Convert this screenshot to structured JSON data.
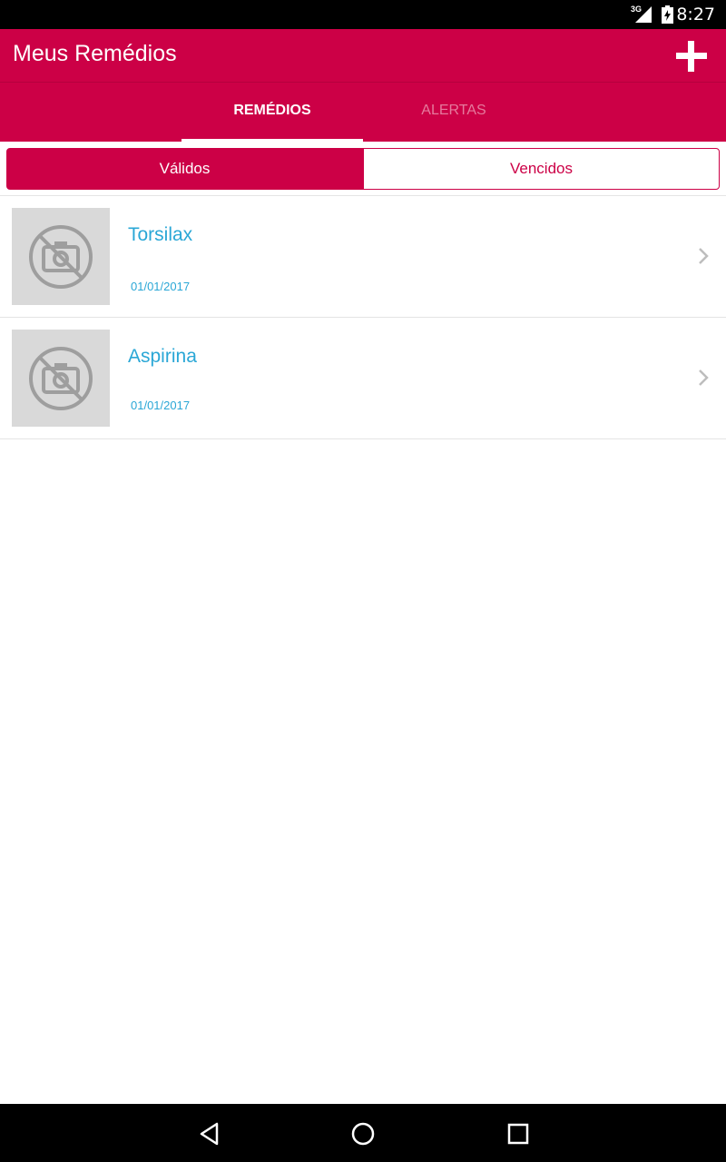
{
  "status_bar": {
    "network": "3G",
    "time": "8:27"
  },
  "app_bar": {
    "title": "Meus Remédios",
    "add_icon": "plus-icon"
  },
  "tabs": [
    {
      "label": "REMÉDIOS",
      "active": true
    },
    {
      "label": "ALERTAS",
      "active": false
    }
  ],
  "filter": {
    "valid_label": "Válidos",
    "expired_label": "Vencidos",
    "selected": "Válidos"
  },
  "medicines": [
    {
      "name": "Torsilax",
      "date": "01/01/2017",
      "thumb_icon": "no-photo-icon"
    },
    {
      "name": "Aspirina",
      "date": "01/01/2017",
      "thumb_icon": "no-photo-icon"
    }
  ],
  "colors": {
    "primary": "#cc0046",
    "accent_text": "#2aa7d6",
    "thumb_bg": "#d9d9d9"
  },
  "nav": {
    "back_icon": "back-triangle-icon",
    "home_icon": "home-circle-icon",
    "recent_icon": "recent-square-icon"
  }
}
